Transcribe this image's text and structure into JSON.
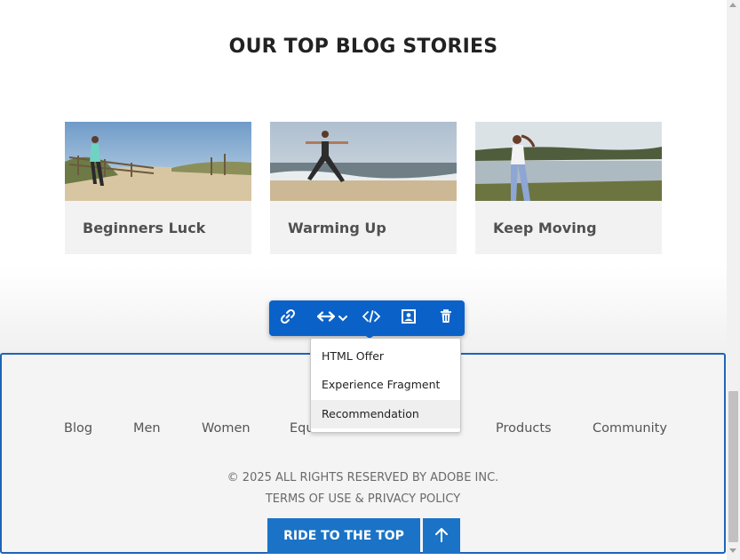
{
  "section": {
    "title": "OUR TOP BLOG STORIES"
  },
  "cards": [
    {
      "title": "Beginners Luck",
      "image_icon": "beach-fence-runner-photo"
    },
    {
      "title": "Warming Up",
      "image_icon": "beach-yoga-photo"
    },
    {
      "title": "Keep Moving",
      "image_icon": "lake-jogger-photo"
    }
  ],
  "toolbar": {
    "icons": [
      "link-icon",
      "resize-horizontal-icon",
      "chevron-down-icon",
      "code-icon",
      "image-target-icon",
      "trash-icon"
    ],
    "accent": "#0a62c9"
  },
  "dropdown": {
    "items": [
      "HTML Offer",
      "Experience Fragment",
      "Recommendation"
    ],
    "hovered": "Recommendation"
  },
  "footer": {
    "nav": [
      "Blog",
      "Men",
      "Women",
      "Equ",
      "Products",
      "Community"
    ],
    "copyright": "© 2025 ALL RIGHTS RESERVED BY ADOBE INC.",
    "terms": "TERMS OF USE & PRIVACY POLICY",
    "ride_button": "RIDE TO THE TOP",
    "border_color": "#1d64b8",
    "button_color": "#1a73c6"
  }
}
